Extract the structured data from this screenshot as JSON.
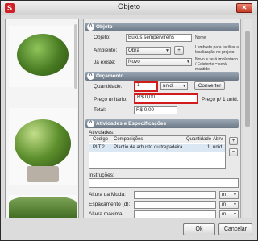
{
  "window": {
    "title": "Objeto",
    "app_icon": "S",
    "close": "✕"
  },
  "sections": {
    "objeto": "Objeto",
    "orcamento": "Orçamento",
    "atividades": "Atividades e Especificações"
  },
  "objeto": {
    "objeto_label": "Objeto:",
    "objeto_value": "Buxus sempervirens",
    "objeto_note": "Nome",
    "ambiente_label": "Ambiente:",
    "ambiente_value": "Obra",
    "add_button": "+",
    "ambiente_note": "Lembrete para facilitar a localização no projeto.",
    "ja_existe_label": "Já existe:",
    "ja_existe_value": "Novo",
    "ja_existe_note": "Novo = será implantado / Existente = será mantido"
  },
  "orcamento": {
    "quantidade_label": "Quantidade:",
    "quantidade_value": "1",
    "unidade_value": "unid.",
    "converter_button": "Converter",
    "preco_label": "Preço unitário:",
    "preco_value": "R$ 0,00",
    "preco_note": "Preço p/ 1 unid.",
    "total_label": "Total:",
    "total_value": "R$ 0,00"
  },
  "atividades": {
    "label": "Atividades:",
    "columns": [
      "Código",
      "Composições",
      "Quantidade",
      "Abrv"
    ],
    "rows": [
      {
        "codigo": "PLT.2",
        "composicao": "Plantio de arbusto ou trepadeira",
        "quantidade": "1",
        "abrv": "unid."
      }
    ],
    "add_button": "+",
    "remove_button": "−",
    "instrucoes_label": "Instruções:",
    "altura_muda_label": "Altura da Muda:",
    "espacamento_label": "Espaçamento (d):",
    "altura_max_label": "Altura máxima:",
    "unit_m": "m"
  },
  "footer": {
    "ok": "Ok",
    "cancelar": "Cancelar"
  },
  "colors": {
    "section_header": "#6c7886",
    "highlight_border": "#d21c1c",
    "selected_row": "#dbe7f3"
  }
}
